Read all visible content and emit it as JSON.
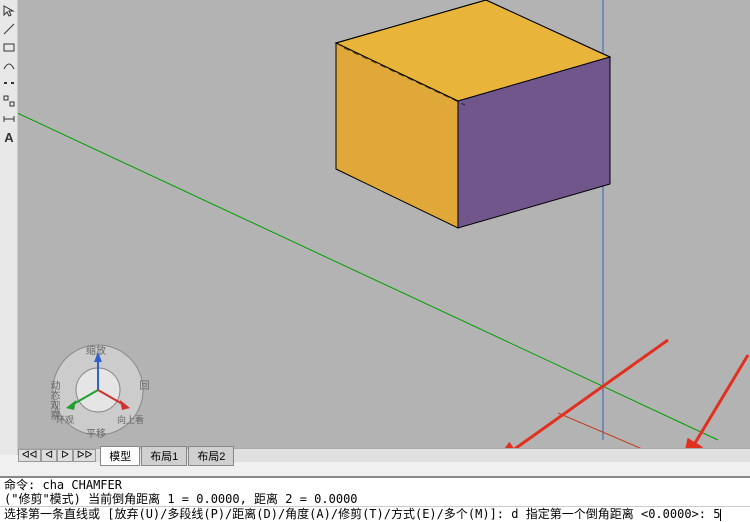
{
  "tools": [
    "pick",
    "rect",
    "break",
    "ortho",
    "text-a"
  ],
  "viewcube": {
    "labels": [
      "缩放",
      "环观",
      "向上看",
      "回",
      "平移",
      "动态观察"
    ]
  },
  "tabs": {
    "active": "模型",
    "items": [
      "模型",
      "布局1",
      "布局2"
    ]
  },
  "command_history": {
    "line1_prefix": "命令:",
    "line1_cmd": "cha",
    "line1_cmd_upper": "CHAMFER",
    "line2": "(\"修剪\"模式) 当前倒角距离 1 = 0.0000, 距离 2 = 0.0000"
  },
  "command_prompt": {
    "prefix": "选择第一条直线或",
    "options": [
      {
        "label": "放弃",
        "key": "U"
      },
      {
        "label": "多段线",
        "key": "P"
      },
      {
        "label": "距离",
        "key": "D"
      },
      {
        "label": "角度",
        "key": "A"
      },
      {
        "label": "修剪",
        "key": "T"
      },
      {
        "label": "方式",
        "key": "E"
      },
      {
        "label": "多个",
        "key": "M"
      }
    ],
    "input_option": "d",
    "next_prompt": "指定第一个倒角距离",
    "default_value": "0.0000",
    "user_input": "5"
  },
  "colors": {
    "box_top": "#e8b53a",
    "box_front": "#e0a838",
    "box_side": "#71568c",
    "axis_green": "#00a000",
    "axis_blue": "#3060c0",
    "arrow_red": "#e03020"
  }
}
